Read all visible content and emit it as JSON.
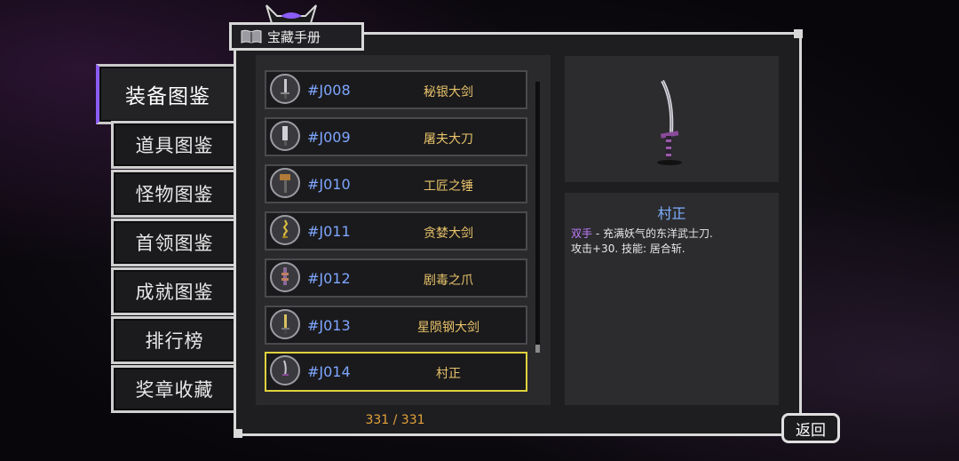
{
  "header": {
    "title": "宝藏手册"
  },
  "sidebar": {
    "items": [
      {
        "label": "装备图鉴",
        "active": true
      },
      {
        "label": "道具图鉴",
        "active": false
      },
      {
        "label": "怪物图鉴",
        "active": false
      },
      {
        "label": "首领图鉴",
        "active": false
      },
      {
        "label": "成就图鉴",
        "active": false
      },
      {
        "label": "排行榜",
        "active": false
      },
      {
        "label": "奖章收藏",
        "active": false
      }
    ]
  },
  "list": {
    "items": [
      {
        "code": "#J008",
        "name": "秘银大剑",
        "icon": "greatsword-icon"
      },
      {
        "code": "#J009",
        "name": "屠夫大刀",
        "icon": "cleaver-icon"
      },
      {
        "code": "#J010",
        "name": "工匠之锤",
        "icon": "hammer-icon"
      },
      {
        "code": "#J011",
        "name": "贪婪大剑",
        "icon": "golden-sword-icon"
      },
      {
        "code": "#J012",
        "name": "剧毒之爪",
        "icon": "claw-icon"
      },
      {
        "code": "#J013",
        "name": "星陨钢大剑",
        "icon": "meteor-sword-icon"
      },
      {
        "code": "#J014",
        "name": "村正",
        "icon": "katana-icon",
        "selected": true
      }
    ],
    "counter": "331 / 331"
  },
  "detail": {
    "title": "村正",
    "tag": "双手",
    "line1_rest": " - 充满妖气的东洋武士刀.",
    "line2": "攻击+30. 技能: 居合斩.",
    "image": "muramasa-katana"
  },
  "footer": {
    "back_label": "返回"
  },
  "colors": {
    "accent_purple": "#8b5cf6",
    "code_blue": "#7ea6ff",
    "name_gold": "#e8c36a",
    "selected_border": "#e0d23c",
    "counter_orange": "#e5a33a"
  }
}
